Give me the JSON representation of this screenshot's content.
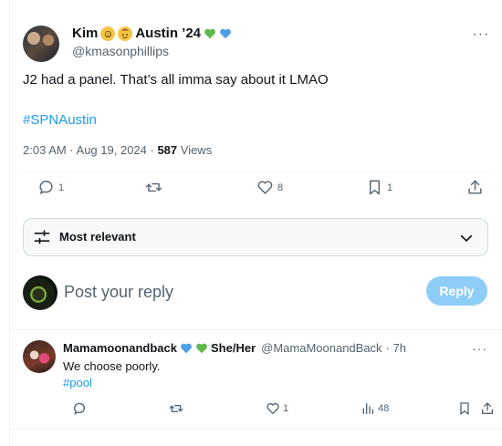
{
  "post": {
    "display_name_part1": "Kim",
    "display_name_part2": "Austin ’24",
    "handle": "@kmasonphillips",
    "text": "J2 had a panel. That’s all imma say about it LMAO",
    "hashtag": "#SPNAustin",
    "time": "2:03 AM · Aug 19, 2024 · ",
    "views_count": "587",
    "views_label": " Views",
    "more": "···",
    "actions": {
      "replies": "1",
      "reposts": "",
      "likes": "8",
      "bookmarks": "1"
    }
  },
  "sort": {
    "label": "Most relevant"
  },
  "composer": {
    "placeholder": "Post your reply",
    "button": "Reply"
  },
  "reply": {
    "display_name": "Mamamoonandback",
    "pronouns": "She/Her",
    "handle": "@MamaMoonandBack",
    "time": "· 7h",
    "text": "We choose poorly.",
    "hashtag": "#pool",
    "more": "···",
    "actions": {
      "replies": "",
      "reposts": "",
      "likes": "1",
      "views": "48"
    }
  },
  "colors": {
    "accent": "#1d9bf0",
    "muted": "#536471",
    "reply_button": "#8ecdf8",
    "heart_green": "#5fb84e",
    "heart_blue": "#4d9fe8"
  },
  "icons": {
    "angel": "smiling-face-with-halo",
    "cowboy": "cowboy-hat-face",
    "reply": "speech-bubble",
    "repost": "repost-arrows",
    "like": "heart-outline",
    "bookmark": "bookmark",
    "share": "share-up-arrow",
    "views": "bar-chart",
    "sort": "sliders",
    "chevron": "chevron-down"
  }
}
